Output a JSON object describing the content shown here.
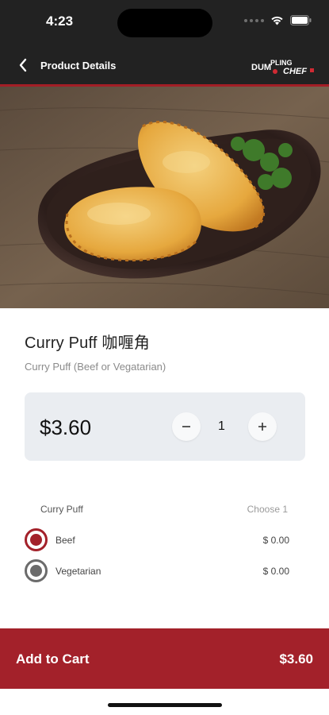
{
  "status_bar": {
    "time": "4:23"
  },
  "navbar": {
    "title": "Product Details",
    "logo_text_1": "DUMPLING",
    "logo_text_2": "CHEF"
  },
  "product": {
    "name": "Curry Puff 咖喱角",
    "description": "Curry Puff (Beef or Vegatarian)",
    "price": "$3.60",
    "quantity": "1"
  },
  "options": {
    "group_title": "Curry Puff",
    "choose_text": "Choose 1",
    "items": [
      {
        "label": "Beef",
        "price": "$ 0.00",
        "selected": true
      },
      {
        "label": "Vegetarian",
        "price": "$ 0.00",
        "selected": false
      }
    ]
  },
  "cart": {
    "label": "Add to Cart",
    "total": "$3.60"
  },
  "colors": {
    "brand_red": "#a3212a",
    "header_dark": "#222222",
    "card_bg": "#eaedf1"
  }
}
